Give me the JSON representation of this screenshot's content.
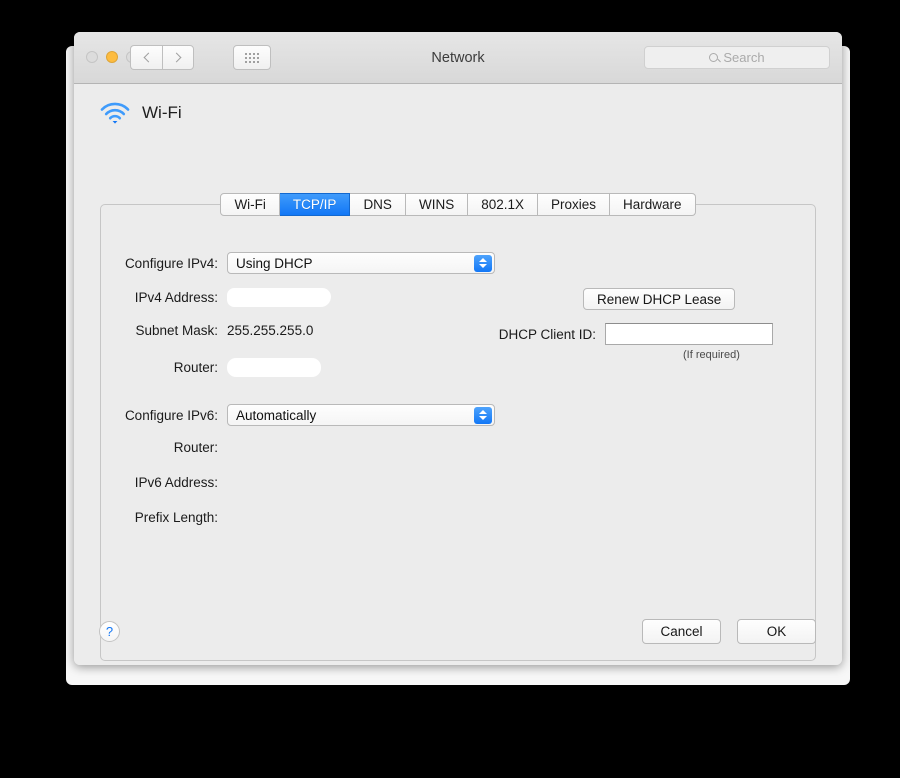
{
  "window": {
    "title": "Network",
    "traffic_lights": [
      {
        "name": "close-button",
        "state": "disabled",
        "color": "#dcdcdc"
      },
      {
        "name": "minimize-button",
        "state": "enabled",
        "color": "#fdbc40"
      },
      {
        "name": "zoom-button",
        "state": "disabled",
        "color": "#dcdcdc"
      }
    ],
    "toolbar": {
      "back_icon": "chevron-left-icon",
      "forward_icon": "chevron-right-icon",
      "show_all_icon": "grid-dots-icon",
      "search": {
        "icon": "search-icon",
        "placeholder": "Search",
        "value": ""
      }
    }
  },
  "service": {
    "icon": "wifi-icon",
    "name": "Wi-Fi",
    "accent_color": "#1277f6"
  },
  "tabs": [
    {
      "label": "Wi-Fi",
      "selected": false
    },
    {
      "label": "TCP/IP",
      "selected": true
    },
    {
      "label": "DNS",
      "selected": false
    },
    {
      "label": "WINS",
      "selected": false
    },
    {
      "label": "802.1X",
      "selected": false
    },
    {
      "label": "Proxies",
      "selected": false
    },
    {
      "label": "Hardware",
      "selected": false
    }
  ],
  "ipv4": {
    "configure_label": "Configure IPv4:",
    "configure_value": "Using DHCP",
    "address_label": "IPv4 Address:",
    "address_value": "",
    "address_redacted": true,
    "subnet_label": "Subnet Mask:",
    "subnet_value": "255.255.255.0",
    "router_label": "Router:",
    "router_value": "",
    "router_redacted": true
  },
  "dhcp": {
    "renew_button": "Renew DHCP Lease",
    "client_id_label": "DHCP Client ID:",
    "client_id_value": "",
    "client_id_hint": "(If required)"
  },
  "ipv6": {
    "configure_label": "Configure IPv6:",
    "configure_value": "Automatically",
    "router_label": "Router:",
    "router_value": "",
    "address_label": "IPv6 Address:",
    "address_value": "",
    "prefix_label": "Prefix Length:",
    "prefix_value": ""
  },
  "footer": {
    "help_glyph": "?",
    "cancel_label": "Cancel",
    "ok_label": "OK"
  }
}
